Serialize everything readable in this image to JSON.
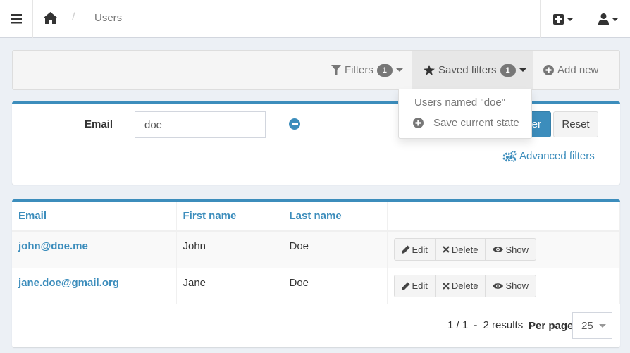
{
  "header": {
    "icons": {
      "menu": "bars-icon",
      "home": "home-icon",
      "plus": "plus-square-icon",
      "user": "user-icon"
    },
    "breadcrumb": {
      "separator": "/",
      "current": "Users"
    }
  },
  "actions": {
    "filters": {
      "label": "Filters",
      "count": "1"
    },
    "saved_filters": {
      "label": "Saved filters",
      "count": "1"
    },
    "add_new": {
      "label": "Add new"
    }
  },
  "saved_filters_dropdown": {
    "items": [
      "Users named \"doe\"",
      "Save current state"
    ]
  },
  "filter_form": {
    "email_label": "Email",
    "email_value": "doe",
    "filter_button": "er",
    "reset_button": "Reset",
    "advanced_filters": "Advanced filters"
  },
  "table": {
    "columns": [
      "Email",
      "First name",
      "Last name"
    ],
    "rows": [
      {
        "email": "john@doe.me",
        "first_name": "John",
        "last_name": "Doe"
      },
      {
        "email": "jane.doe@gmail.org",
        "first_name": "Jane",
        "last_name": "Doe"
      }
    ],
    "row_actions": {
      "edit": "Edit",
      "delete": "Delete",
      "show": "Show"
    }
  },
  "pagination": {
    "page": "1 / 1",
    "sep1": "-",
    "results": "2 results",
    "sep2": "-",
    "per_page_label": "Per page",
    "per_page_value": "25"
  },
  "colors": {
    "accent": "#3c8dbc",
    "muted": "#777777"
  }
}
